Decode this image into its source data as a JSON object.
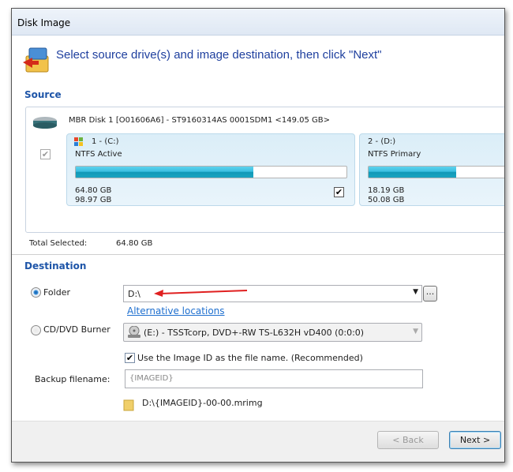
{
  "window": {
    "title": "Disk Image"
  },
  "header": {
    "instruction": "Select source drive(s) and image destination, then click \"Next\""
  },
  "source": {
    "label": "Source",
    "disk": {
      "description": "MBR Disk 1 [O01606A6] - ST9160314AS 0001SDM1  <149.05 GB>",
      "checked": true
    },
    "partitions": [
      {
        "name": "1 - (C:)",
        "type": "NTFS Active",
        "used": "64.80 GB",
        "total": "98.97 GB",
        "used_fraction": 0.655,
        "checked": true
      },
      {
        "name": "2 - (D:)",
        "type": "NTFS Primary",
        "used": "18.19 GB",
        "total": "50.08 GB",
        "used_fraction": 0.363
      }
    ],
    "total_selected_label": "Total Selected:",
    "total_selected_value": "64.80 GB"
  },
  "destination": {
    "label": "Destination",
    "folder_label": "Folder",
    "folder_value": "D:\\",
    "folder_selected": true,
    "browse_label": "...",
    "alt_locations": "Alternative locations",
    "burner_label": "CD/DVD Burner",
    "burner_value": "(E:) - TSSTcorp, DVD+-RW TS-L632H vD400 (0:0:0)",
    "use_image_id_label": "Use the Image ID as the file name.  (Recommended)",
    "use_image_id_checked": true,
    "backup_filename_label": "Backup filename:",
    "backup_filename_value": "{IMAGEID}",
    "resulting_path": "D:\\{IMAGEID}-00-00.mrimg"
  },
  "buttons": {
    "back": "< Back",
    "next": "Next >"
  },
  "colors": {
    "accent": "#1e55a8",
    "arrow": "#e02020",
    "bar": "#1aa3c0"
  }
}
